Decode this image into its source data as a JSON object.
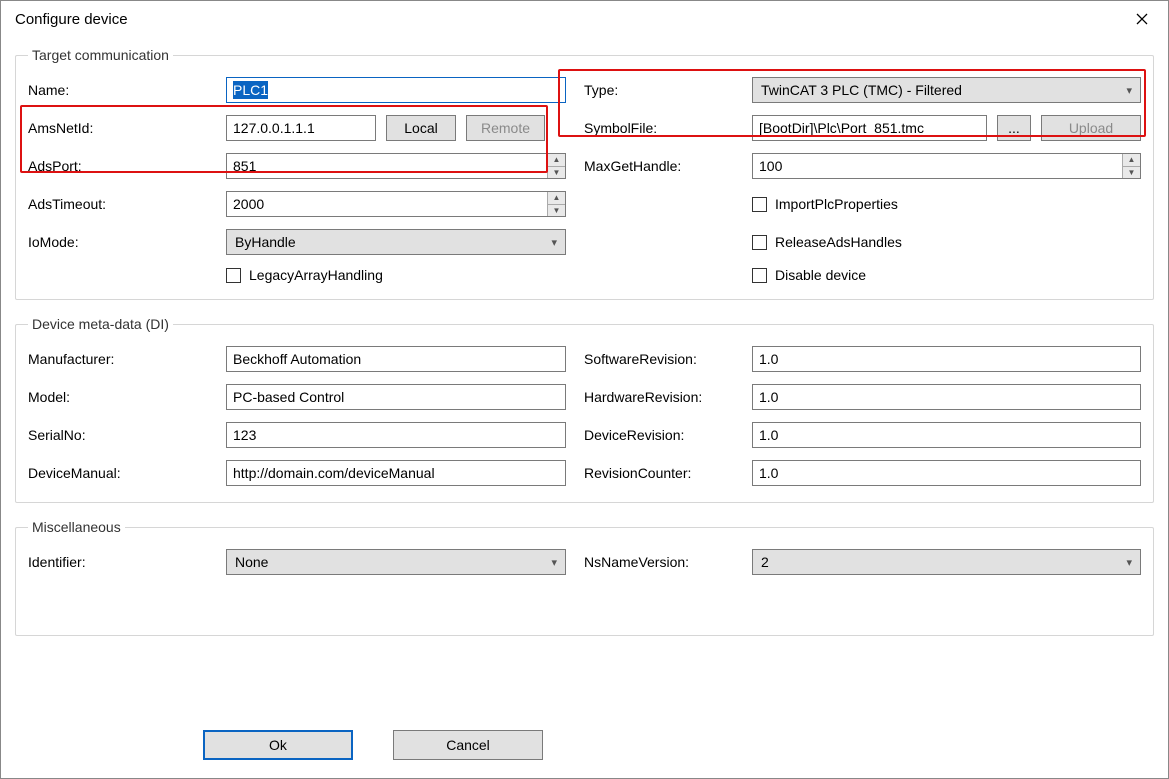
{
  "window": {
    "title": "Configure device"
  },
  "groups": {
    "target": "Target communication",
    "meta": "Device meta-data (DI)",
    "misc": "Miscellaneous"
  },
  "target": {
    "name_label": "Name:",
    "name_value": "PLC1",
    "amsnetid_label": "AmsNetId:",
    "amsnetid_value": "127.0.0.1.1.1",
    "local_btn": "Local",
    "remote_btn": "Remote",
    "adsport_label": "AdsPort:",
    "adsport_value": "851",
    "adstimeout_label": "AdsTimeout:",
    "adstimeout_value": "2000",
    "iomode_label": "IoMode:",
    "iomode_value": "ByHandle",
    "legacy_label": "LegacyArrayHandling",
    "type_label": "Type:",
    "type_value": "TwinCAT 3 PLC (TMC) - Filtered",
    "symfile_label": "SymbolFile:",
    "symfile_value": "[BootDir]\\Plc\\Port_851.tmc",
    "browse_btn": "...",
    "upload_btn": "Upload",
    "maxhandle_label": "MaxGetHandle:",
    "maxhandle_value": "100",
    "importplc_label": "ImportPlcProperties",
    "releaseads_label": "ReleaseAdsHandles",
    "disabledev_label": "Disable device"
  },
  "meta": {
    "manufacturer_label": "Manufacturer:",
    "manufacturer_value": "Beckhoff Automation",
    "model_label": "Model:",
    "model_value": "PC-based Control",
    "serial_label": "SerialNo:",
    "serial_value": "123",
    "manual_label": "DeviceManual:",
    "manual_value": "http://domain.com/deviceManual",
    "swrev_label": "SoftwareRevision:",
    "swrev_value": "1.0",
    "hwrev_label": "HardwareRevision:",
    "hwrev_value": "1.0",
    "devrev_label": "DeviceRevision:",
    "devrev_value": "1.0",
    "revcnt_label": "RevisionCounter:",
    "revcnt_value": "1.0"
  },
  "misc": {
    "identifier_label": "Identifier:",
    "identifier_value": "None",
    "nsver_label": "NsNameVersion:",
    "nsver_value": "2"
  },
  "footer": {
    "ok": "Ok",
    "cancel": "Cancel"
  }
}
